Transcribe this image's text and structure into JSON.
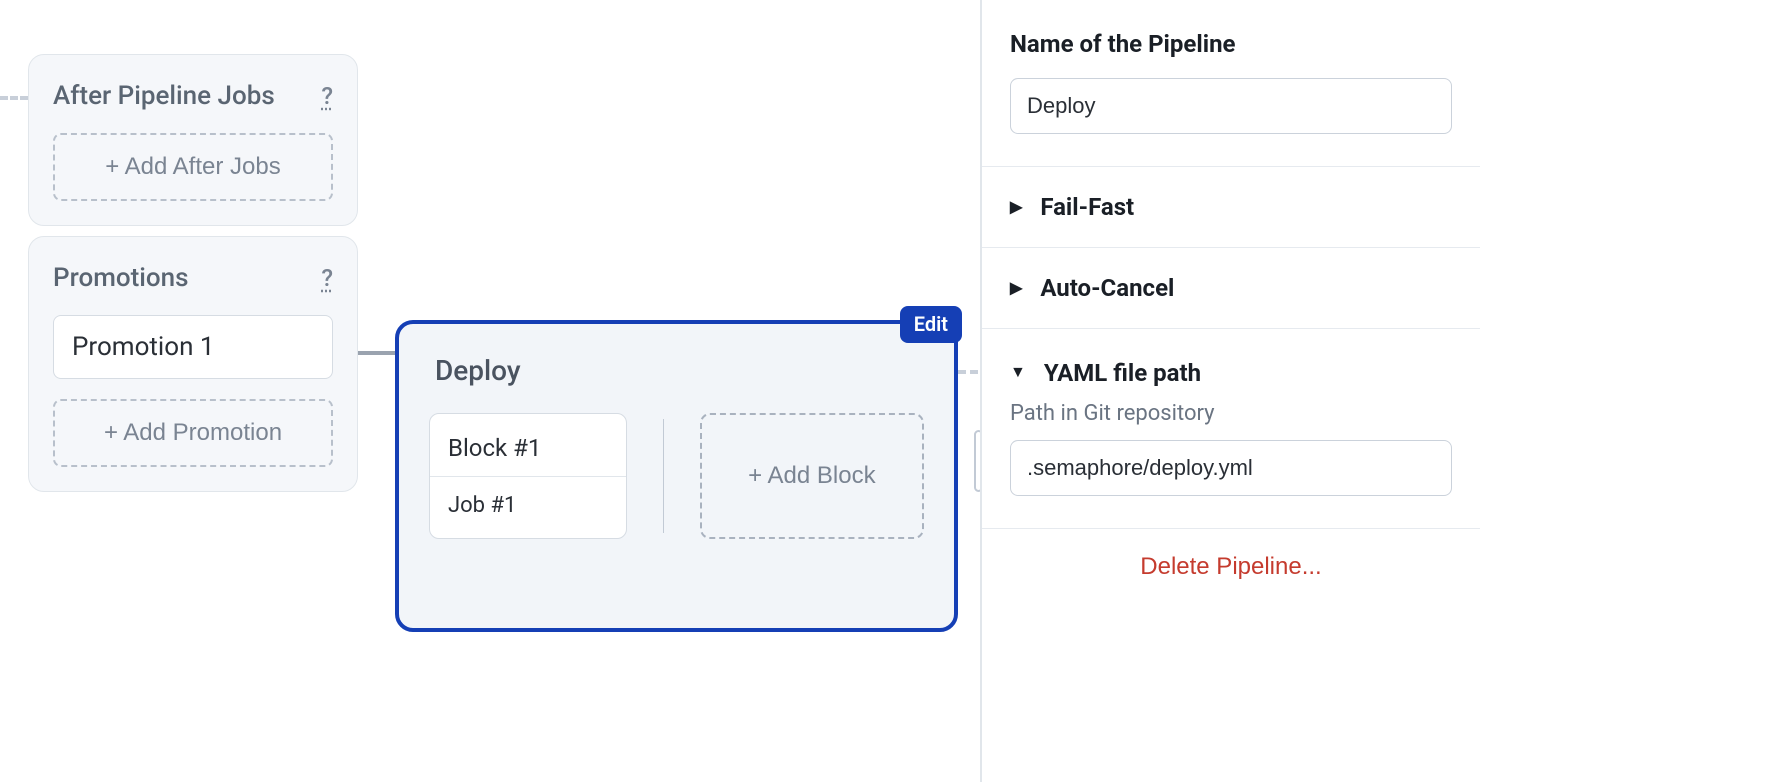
{
  "left": {
    "after_pipeline": {
      "title": "After Pipeline Jobs",
      "help": "?",
      "add_label": "+ Add After Jobs"
    },
    "promotions": {
      "title": "Promotions",
      "help": "?",
      "items": [
        {
          "label": "Promotion 1"
        }
      ],
      "add_label": "+ Add Promotion"
    }
  },
  "pipeline": {
    "edit_label": "Edit",
    "title": "Deploy",
    "blocks": [
      {
        "title": "Block #1",
        "jobs": [
          "Job #1"
        ]
      }
    ],
    "add_block_label": "+ Add Block"
  },
  "right": {
    "name_section": {
      "heading": "Name of the Pipeline",
      "value": "Deploy"
    },
    "failfast_heading": "Fail-Fast",
    "autocancel_heading": "Auto-Cancel",
    "yaml_section": {
      "heading": "YAML file path",
      "sublabel": "Path in Git repository",
      "value": ".semaphore/deploy.yml"
    },
    "delete_label": "Delete Pipeline..."
  }
}
